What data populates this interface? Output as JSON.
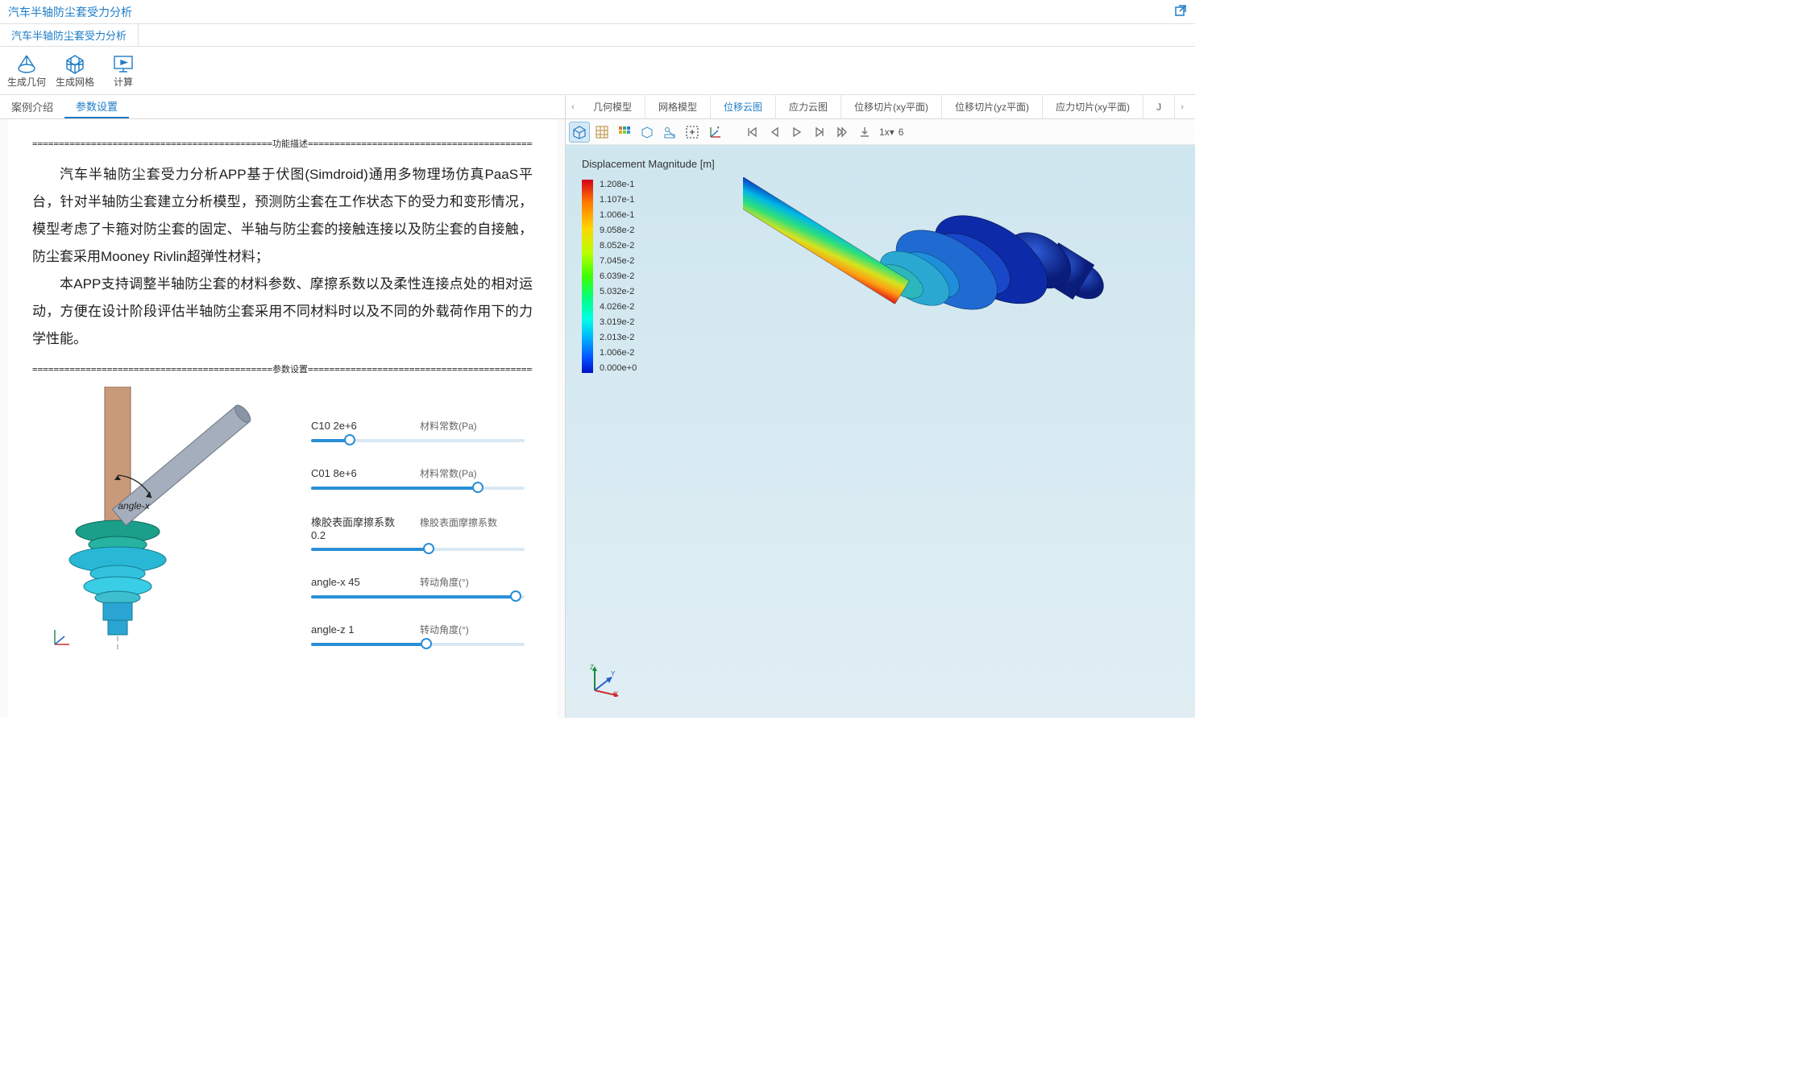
{
  "app_title": "汽车半轴防尘套受力分析",
  "breadcrumb": "汽车半轴防尘套受力分析",
  "toolbar": {
    "gen_geom": "生成几何",
    "gen_mesh": "生成网格",
    "compute": "计算"
  },
  "left_tabs": {
    "intro": "案例介绍",
    "params": "参数设置"
  },
  "section_headers": {
    "func": "功能描述",
    "params": "参数设置"
  },
  "description": {
    "p1": "汽车半轴防尘套受力分析APP基于伏图(Simdroid)通用多物理场仿真PaaS平台，针对半轴防尘套建立分析模型，预测防尘套在工作状态下的受力和变形情况，模型考虑了卡箍对防尘套的固定、半轴与防尘套的接触连接以及防尘套的自接触，防尘套采用Mooney Rivlin超弹性材料；",
    "p2": "本APP支持调整半轴防尘套的材料参数、摩擦系数以及柔性连接点处的相对运动，方便在设计阶段评估半轴防尘套采用不同材料时以及不同的外载荷作用下的力学性能。"
  },
  "diagram_label": "angle-x",
  "params": [
    {
      "name": "C10",
      "value": "2e+6",
      "desc": "材料常数(Pa)",
      "pct": 18
    },
    {
      "name": "C01",
      "value": "8e+6",
      "desc": "材料常数(Pa)",
      "pct": 78
    },
    {
      "name": "橡胶表面摩擦系数",
      "value": "0.2",
      "desc": "橡胶表面摩擦系数",
      "pct": 55
    },
    {
      "name": "angle-x",
      "value": "45",
      "desc": "转动角度(°)",
      "pct": 96
    },
    {
      "name": "angle-z",
      "value": "1",
      "desc": "转动角度(°)",
      "pct": 54
    }
  ],
  "right_tabs": [
    "几何模型",
    "网格模型",
    "位移云图",
    "应力云图",
    "位移切片(xy平面)",
    "位移切片(yz平面)",
    "应力切片(xy平面)"
  ],
  "right_tabs_trail": "J",
  "right_tab_active": 2,
  "anim": {
    "speed": "1x",
    "frame": "6"
  },
  "legend": {
    "title": "Displacement Magnitude [m]",
    "ticks": [
      "1.208e-1",
      "1.107e-1",
      "1.006e-1",
      "9.058e-2",
      "8.052e-2",
      "7.045e-2",
      "6.039e-2",
      "5.032e-2",
      "4.026e-2",
      "3.019e-2",
      "2.013e-2",
      "1.006e-2",
      "0.000e+0"
    ]
  },
  "axes": {
    "x": "X",
    "y": "Y",
    "z": "Z"
  }
}
